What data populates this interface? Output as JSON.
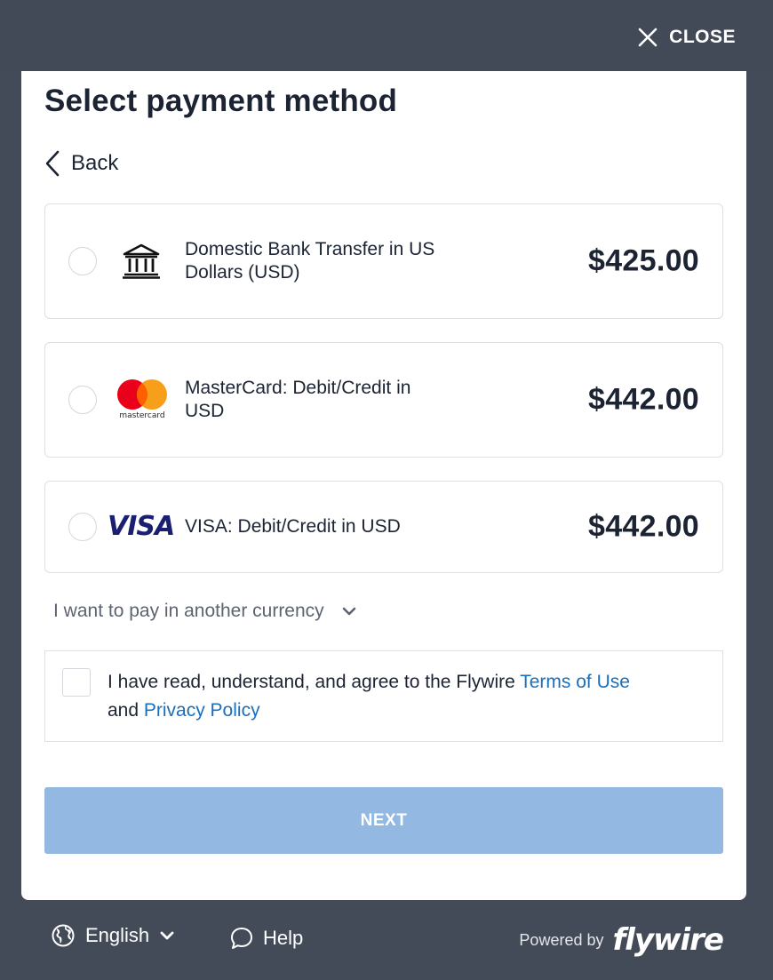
{
  "header": {
    "close_label": "CLOSE"
  },
  "main": {
    "title": "Select payment method",
    "back_label": "Back",
    "options": [
      {
        "icon": "bank-icon",
        "label": "Domestic Bank Transfer in US Dollars (USD)",
        "amount": "$425.00"
      },
      {
        "icon": "mastercard-logo",
        "label": "MasterCard: Debit/Credit in USD",
        "amount": "$442.00",
        "logo_text": "mastercard"
      },
      {
        "icon": "visa-logo",
        "label": "VISA: Debit/Credit in USD",
        "amount": "$442.00",
        "logo_text": "VISA"
      }
    ],
    "currency_toggle": "I want to pay in another currency",
    "terms": {
      "text": "I have read, understand, and agree to the Flywire ",
      "terms_link": "Terms of Use",
      "and": "and ",
      "privacy_link": "Privacy Policy"
    },
    "next_label": "NEXT"
  },
  "footer": {
    "language": "English",
    "help": "Help",
    "powered_by": "Powered by",
    "brand": "flywire"
  },
  "colors": {
    "background": "#444b58",
    "link": "#1a6fbd",
    "next_disabled": "#93b9e3",
    "mastercard_red": "#eb001b",
    "mastercard_orange": "#f79e1b",
    "visa_blue": "#1a1f71"
  }
}
